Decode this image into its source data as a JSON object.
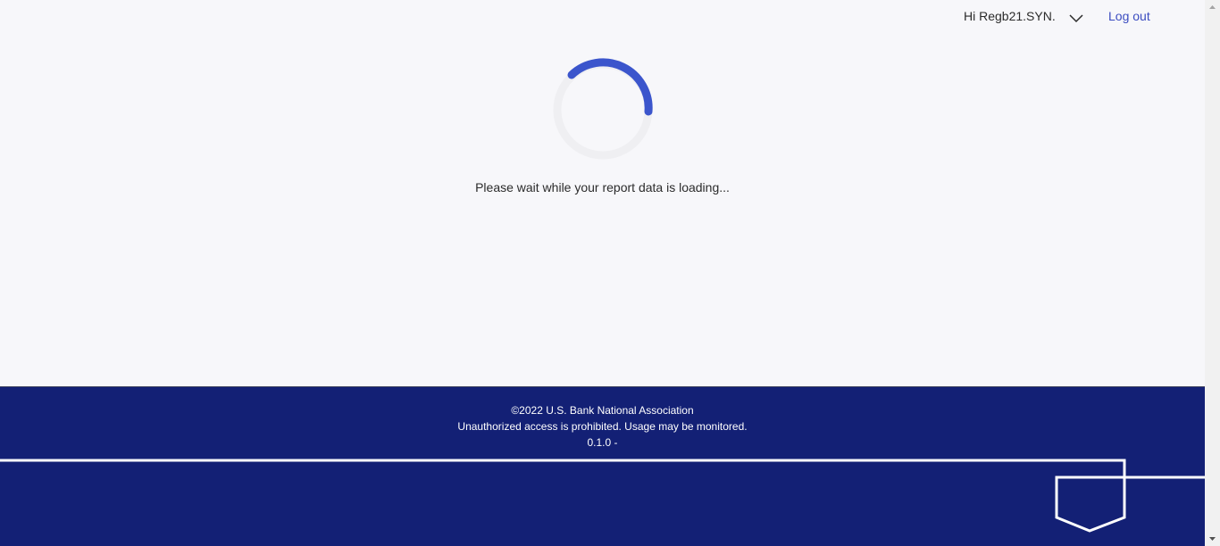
{
  "header": {
    "greeting": "Hi Regb21.SYN.",
    "logout_label": "Log out"
  },
  "main": {
    "loading_message": "Please wait while your report data is loading..."
  },
  "footer": {
    "copyright": "©2022 U.S. Bank National Association",
    "warning": "Unauthorized access is prohibited. Usage may be monitored.",
    "version": "0.1.0 -"
  },
  "colors": {
    "brand_navy": "#132075",
    "accent_blue": "#3b55cc",
    "link": "#3b4cc0",
    "background": "#f7f7fa"
  },
  "icons": {
    "user_menu": "chevron-down-icon",
    "loader": "spinner-icon",
    "brand": "shield-icon"
  }
}
